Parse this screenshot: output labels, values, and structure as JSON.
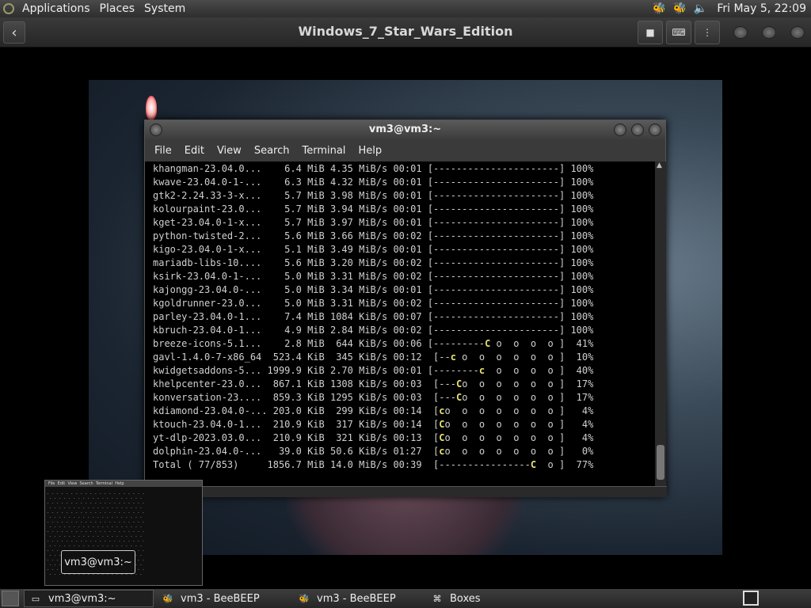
{
  "top_panel": {
    "menus": [
      "Applications",
      "Places",
      "System"
    ],
    "clock": "Fri May  5, 22:09",
    "tray_icons": [
      "beebeep-icon",
      "beebeep-icon",
      "volume-icon"
    ]
  },
  "vm_header": {
    "title": "Windows_7_Star_Wars_Edition",
    "back_icon": "‹",
    "buttons": [
      "stop-icon",
      "keyboard-icon",
      "menu-icon"
    ]
  },
  "terminal": {
    "title": "vm3@vm3:~",
    "menu": [
      "File",
      "Edit",
      "View",
      "Search",
      "Terminal",
      "Help"
    ],
    "rows": [
      {
        "name": "khangman-23.04.0...",
        "size": "6.4 MiB",
        "speed": "4.35 MiB/s",
        "time": "00:01",
        "bar": "[----------------------]",
        "pct": "100%"
      },
      {
        "name": "kwave-23.04.0-1-...",
        "size": "6.3 MiB",
        "speed": "4.32 MiB/s",
        "time": "00:01",
        "bar": "[----------------------]",
        "pct": "100%"
      },
      {
        "name": "gtk2-2.24.33-3-x...",
        "size": "5.7 MiB",
        "speed": "3.98 MiB/s",
        "time": "00:01",
        "bar": "[----------------------]",
        "pct": "100%"
      },
      {
        "name": "kolourpaint-23.0...",
        "size": "5.7 MiB",
        "speed": "3.94 MiB/s",
        "time": "00:01",
        "bar": "[----------------------]",
        "pct": "100%"
      },
      {
        "name": "kget-23.04.0-1-x...",
        "size": "5.7 MiB",
        "speed": "3.97 MiB/s",
        "time": "00:01",
        "bar": "[----------------------]",
        "pct": "100%"
      },
      {
        "name": "python-twisted-2...",
        "size": "5.6 MiB",
        "speed": "3.66 MiB/s",
        "time": "00:02",
        "bar": "[----------------------]",
        "pct": "100%"
      },
      {
        "name": "kigo-23.04.0-1-x...",
        "size": "5.1 MiB",
        "speed": "3.49 MiB/s",
        "time": "00:01",
        "bar": "[----------------------]",
        "pct": "100%"
      },
      {
        "name": "mariadb-libs-10....",
        "size": "5.6 MiB",
        "speed": "3.20 MiB/s",
        "time": "00:02",
        "bar": "[----------------------]",
        "pct": "100%"
      },
      {
        "name": "ksirk-23.04.0-1-...",
        "size": "5.0 MiB",
        "speed": "3.31 MiB/s",
        "time": "00:02",
        "bar": "[----------------------]",
        "pct": "100%"
      },
      {
        "name": "kajongg-23.04.0-...",
        "size": "5.0 MiB",
        "speed": "3.34 MiB/s",
        "time": "00:01",
        "bar": "[----------------------]",
        "pct": "100%"
      },
      {
        "name": "kgoldrunner-23.0...",
        "size": "5.0 MiB",
        "speed": "3.31 MiB/s",
        "time": "00:02",
        "bar": "[----------------------]",
        "pct": "100%"
      },
      {
        "name": "parley-23.04.0-1...",
        "size": "7.4 MiB",
        "speed": "1084 KiB/s",
        "time": "00:07",
        "bar": "[----------------------]",
        "pct": "100%"
      },
      {
        "name": "kbruch-23.04.0-1...",
        "size": "4.9 MiB",
        "speed": "2.84 MiB/s",
        "time": "00:02",
        "bar": "[----------------------]",
        "pct": "100%"
      },
      {
        "name": "breeze-icons-5.1...",
        "size": "2.8 MiB",
        "speed": " 644 KiB/s",
        "time": "00:06",
        "bar": "[---------C o  o  o  o ]",
        "pct": " 41%"
      },
      {
        "name": "gavl-1.4.0-7-x86_64",
        "size": "523.4 KiB",
        "speed": " 345 KiB/s",
        "time": "00:12",
        "bar": "[--c o  o  o  o  o  o ]",
        "pct": " 10%"
      },
      {
        "name": "kwidgetsaddons-5...",
        "size": "1999.9 KiB",
        "speed": "2.70 MiB/s",
        "time": "00:01",
        "bar": "[--------c  o  o  o  o ]",
        "pct": " 40%"
      },
      {
        "name": "khelpcenter-23.0...",
        "size": "867.1 KiB",
        "speed": "1308 KiB/s",
        "time": "00:03",
        "bar": "[---Co  o  o  o  o  o ]",
        "pct": " 17%"
      },
      {
        "name": "konversation-23....",
        "size": "859.3 KiB",
        "speed": "1295 KiB/s",
        "time": "00:03",
        "bar": "[---Co  o  o  o  o  o ]",
        "pct": " 17%"
      },
      {
        "name": "kdiamond-23.04.0-...",
        "size": "203.0 KiB",
        "speed": " 299 KiB/s",
        "time": "00:14",
        "bar": "[co  o  o  o  o  o  o ]",
        "pct": "  4%"
      },
      {
        "name": "ktouch-23.04.0-1...",
        "size": "210.9 KiB",
        "speed": " 317 KiB/s",
        "time": "00:14",
        "bar": "[Co  o  o  o  o  o  o ]",
        "pct": "  4%"
      },
      {
        "name": "yt-dlp-2023.03.0...",
        "size": "210.9 KiB",
        "speed": " 321 KiB/s",
        "time": "00:13",
        "bar": "[Co  o  o  o  o  o  o ]",
        "pct": "  4%"
      },
      {
        "name": "dolphin-23.04.0-...",
        "size": "39.0 KiB",
        "speed": "50.6 KiB/s",
        "time": "01:27",
        "bar": "[co  o  o  o  o  o  o ]",
        "pct": "  0%"
      },
      {
        "name": "Total ( 77/853)",
        "size": "1856.7 MiB",
        "speed": "14.0 MiB/s",
        "time": "00:39",
        "bar": "[----------------C  o ]",
        "pct": " 77%"
      }
    ]
  },
  "thumbnail": {
    "tooltip": "vm3@vm3:~",
    "menu": [
      "File",
      "Edit",
      "View",
      "Search",
      "Terminal",
      "Help"
    ]
  },
  "taskbar": {
    "tasks": [
      {
        "label": "vm3@vm3:~",
        "icon": "terminal-icon",
        "active": true
      },
      {
        "label": "vm3 - BeeBEEP",
        "icon": "beebeep-icon",
        "active": false
      },
      {
        "label": "vm3 - BeeBEEP",
        "icon": "beebeep-icon",
        "active": false
      },
      {
        "label": "Boxes",
        "icon": "boxes-icon",
        "active": false
      }
    ]
  }
}
